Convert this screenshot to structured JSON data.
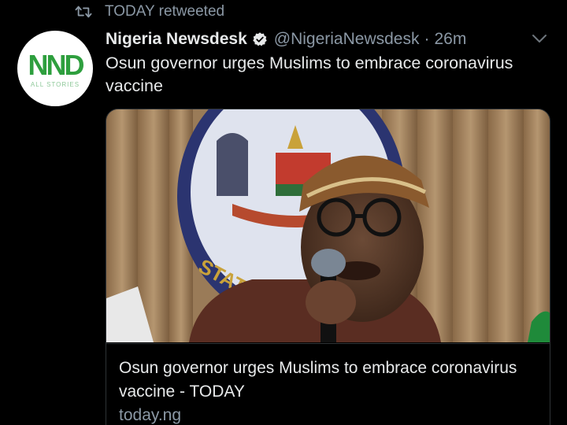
{
  "retweet": {
    "text": "TODAY retweeted"
  },
  "tweet": {
    "display_name": "Nigeria Newsdesk",
    "handle": "@NigeriaNewsdesk",
    "separator": "·",
    "time": "26m",
    "text": "Osun governor urges Muslims to embrace coronavirus vaccine"
  },
  "avatar": {
    "logo_text": "NND",
    "logo_subtext": "ALL STORIES"
  },
  "card": {
    "title": "Osun governor urges Muslims to embrace coronavirus vaccine - TODAY",
    "domain": "today.ng"
  },
  "colors": {
    "background": "#000000",
    "text": "#e7e9ea",
    "muted": "#8b98a5",
    "border": "#2f3336",
    "logo_green": "#2e9f3e"
  }
}
